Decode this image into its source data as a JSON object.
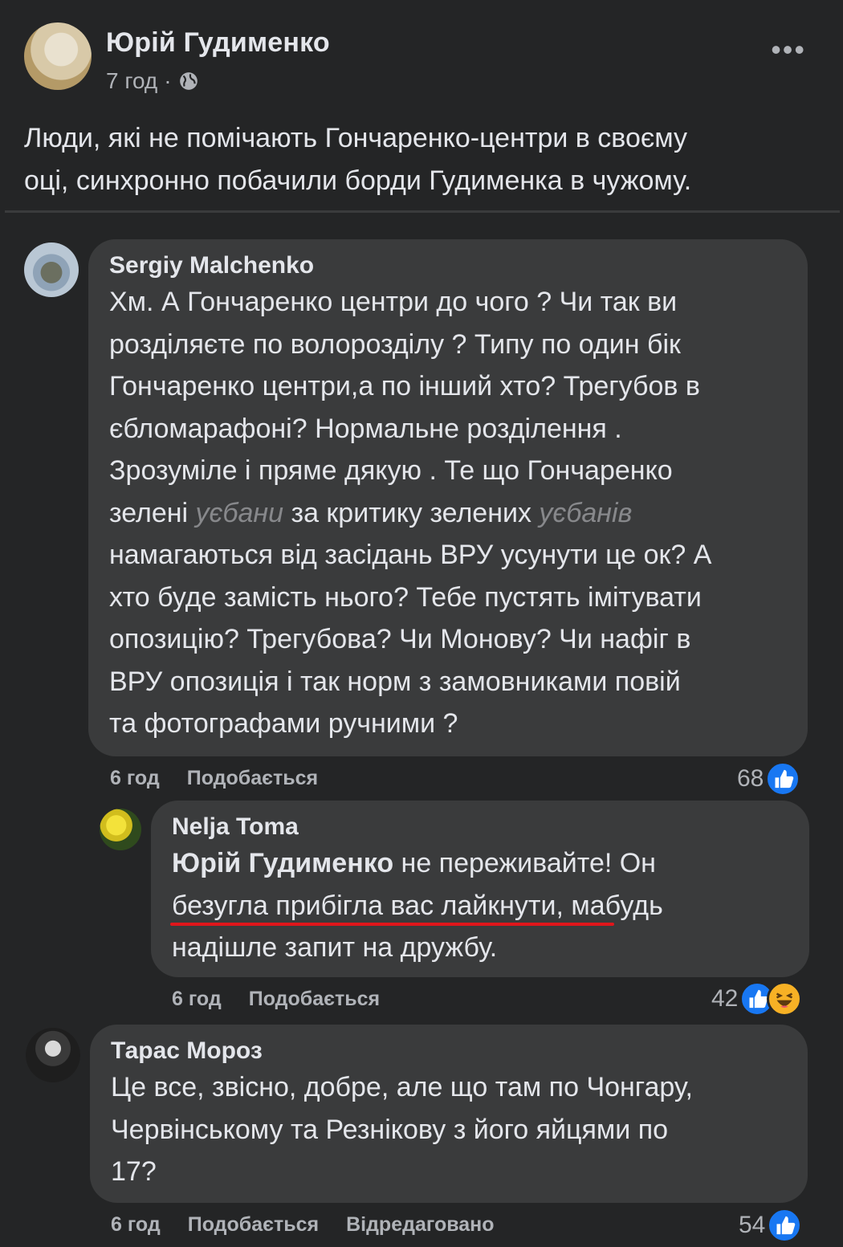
{
  "post": {
    "author": "Юрій Гудименко",
    "time": "7 год",
    "separator": "·",
    "privacy_icon": "globe-icon",
    "more_label": "•••",
    "text_line1": "Люди, які не помічають Гончаренко-центри в своєму",
    "text_line2": "оці, синхронно побачили борди Гудименка в чужому."
  },
  "comments": [
    {
      "name": "Sergiy Malchenko",
      "lines": [
        "Хм. А Гончаренко центри до чого ? Чи так ви",
        "розділяєте по волорозділу ? Типу по один бік",
        "Гончаренко центри,а по інший хто? Трегубов в",
        "єбломарафоні? Нормальне розділення .",
        "Зрозуміле і пряме дякую . Те що Гончаренко"
      ],
      "line6_a": "зелені ",
      "line6_blur1": "уєбани",
      "line6_b": " за критику зелених ",
      "line6_blur2": "уєбанів",
      "lines_tail": [
        "намагаються від засідань ВРУ усунути це ок? А",
        "хто буде замість нього? Тебе пустять імітувати",
        "опозицію? Трегубова? Чи Монову? Чи нафіг в",
        "ВРУ опозиція і так норм з замовниками повій",
        "та фотографами ручними ?"
      ],
      "time": "6 год",
      "like_label": "Подобається",
      "reaction_count": "68",
      "reaction_icons": [
        "like-icon"
      ]
    },
    {
      "name": "Nelja Toma",
      "mention": "Юрій Гудименко",
      "line1_rest": " не переживайте! Он",
      "line2_underlined": "безугла прибігла вас лайкнути,",
      "line2_rest": " мабудь",
      "line3": "надішле запит на дружбу.",
      "time": "6 год",
      "like_label": "Подобається",
      "reaction_count": "42",
      "reaction_icons": [
        "like-icon",
        "haha-icon"
      ]
    },
    {
      "name": "Тарас Мороз",
      "lines": [
        "Це все, звісно, добре, але що там по Чонгару,",
        "Червінському та Резнікову з його яйцями по",
        "17?"
      ],
      "time": "6 год",
      "like_label": "Подобається",
      "edited_label": "Відредаговано",
      "reaction_count": "54",
      "reaction_icons": [
        "like-icon"
      ]
    }
  ],
  "colors": {
    "background": "#242526",
    "bubble": "#3a3b3c",
    "text": "#e4e6eb",
    "secondary": "#b0b3b8",
    "like_blue": "#1877f2",
    "underline_red": "#e0161b"
  }
}
